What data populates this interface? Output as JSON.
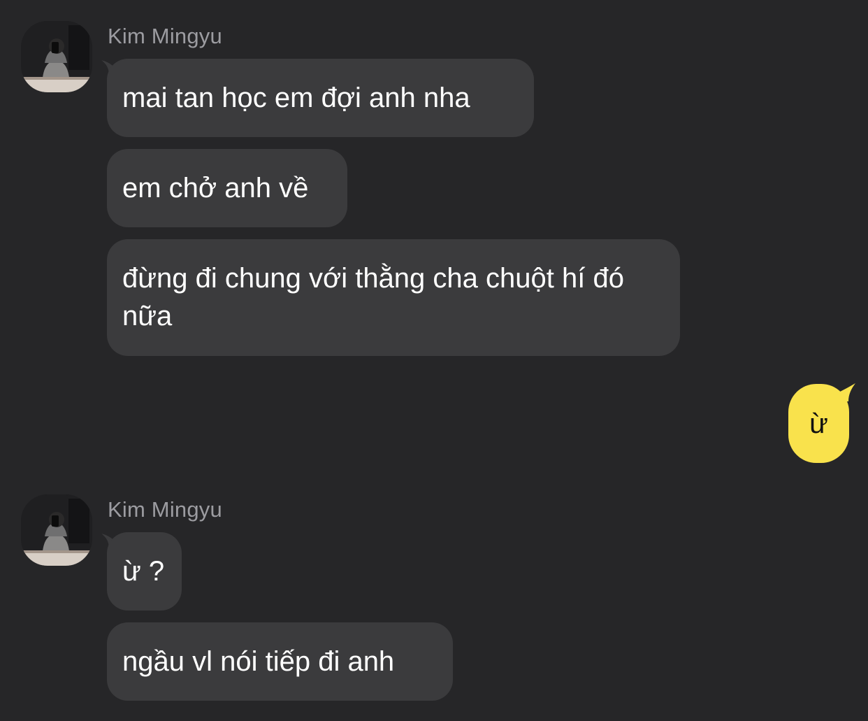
{
  "colors": {
    "background": "#262628",
    "incoming_bubble": "#3b3b3d",
    "outgoing_bubble": "#f9e24c",
    "sender_name": "#9c9ca1"
  },
  "messages": [
    {
      "sender": "Kim Mingyu",
      "direction": "incoming",
      "bubbles": [
        "mai tan học em đợi anh nha",
        "em chở anh về",
        "đừng đi chung với thằng cha chuột hí đó nữa"
      ]
    },
    {
      "direction": "outgoing",
      "bubbles": [
        "ừ"
      ]
    },
    {
      "sender": "Kim Mingyu",
      "direction": "incoming",
      "bubbles": [
        "ừ ?",
        "ngầu vl nói tiếp đi anh"
      ]
    }
  ]
}
